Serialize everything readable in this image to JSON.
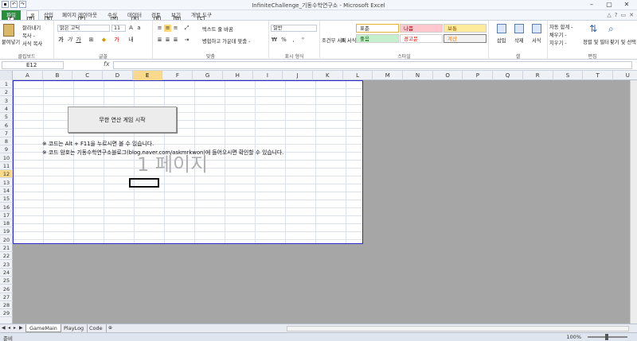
{
  "window": {
    "title": "InfiniteChallenge_기동수학연구소 - Microsoft Excel",
    "qat_keytips": [
      "1",
      "2",
      "3"
    ]
  },
  "tabs": [
    {
      "label": "파일",
      "key": "F"
    },
    {
      "label": "홈",
      "key": "H"
    },
    {
      "label": "삽입",
      "key": "N"
    },
    {
      "label": "페이지 레이아웃",
      "key": "P"
    },
    {
      "label": "수식",
      "key": "M"
    },
    {
      "label": "데이터",
      "key": "A"
    },
    {
      "label": "검토",
      "key": "R"
    },
    {
      "label": "보기",
      "key": "W"
    },
    {
      "label": "개발 도구",
      "key": "L"
    }
  ],
  "ribbon": {
    "clipboard": {
      "paste": "붙여넣기",
      "cut": "잘라내기",
      "copy": "복사 -",
      "format_painter": "서식 복사",
      "label": "클립보드"
    },
    "font": {
      "name": "맑은 고딕",
      "size": "11",
      "label": "글꼴"
    },
    "alignment": {
      "wrap": "텍스트 줄 바꿈",
      "merge": "병합하고 가운데 맞춤 -",
      "label": "맞춤"
    },
    "number": {
      "format": "일반",
      "label": "표시 형식"
    },
    "styles": {
      "cond": "조건부 서식 -",
      "table": "표 서식 -",
      "cells": [
        {
          "label": "표준",
          "color": "#ffffff",
          "text": "#000000"
        },
        {
          "label": "나쁨",
          "color": "#ffc7ce",
          "text": "#9c0006"
        },
        {
          "label": "보통",
          "color": "#ffeb9c",
          "text": "#9c5700"
        },
        {
          "label": "좋음",
          "color": "#c6efce",
          "text": "#006100"
        },
        {
          "label": "경고문",
          "color": "#ffffff",
          "text": "#ff0000"
        },
        {
          "label": "계산",
          "color": "#f2f2f2",
          "text": "#fa7d00"
        }
      ],
      "label": "스타일"
    },
    "cells": {
      "insert": "삽입",
      "delete": "삭제",
      "format": "서식",
      "label": "셀"
    },
    "editing": {
      "autosum": "자동 합계 -",
      "fill": "채우기 -",
      "clear": "지우기 -",
      "sort": "정렬 및 필터 -",
      "find": "찾기 및 선택 -",
      "label": "편집"
    }
  },
  "formula_bar": {
    "name_box": "E12",
    "fx": "fx",
    "value": ""
  },
  "sheet": {
    "columns": [
      "A",
      "B",
      "C",
      "D",
      "E",
      "F",
      "G",
      "H",
      "I",
      "J",
      "K",
      "L",
      "M",
      "N",
      "O",
      "P",
      "Q",
      "R",
      "S",
      "T",
      "U"
    ],
    "selected_column": "E",
    "rows": [
      "1",
      "2",
      "3",
      "4",
      "5",
      "6",
      "7",
      "8",
      "9",
      "10",
      "11",
      "12",
      "13",
      "14",
      "15",
      "16",
      "17",
      "18",
      "19",
      "20",
      "21",
      "22",
      "23",
      "24",
      "25",
      "26",
      "27",
      "28",
      "29"
    ],
    "selected_row": "12",
    "start_button": "무한 연산 게임 시작",
    "notes": [
      "※ 코드는 Alt + F11을 누르시면 볼 수 있습니다.",
      "※ 코드 암호는 기동수학연구소블로그(blog.naver.com/askmrkwon)에 들어오시면 확인할 수 있습니다."
    ],
    "page_watermark": "1 페이지"
  },
  "sheet_tabs": [
    "GameMain",
    "PlayLog",
    "Code"
  ],
  "active_sheet": "GameMain",
  "status": {
    "ready": "준비",
    "zoom": "100%"
  }
}
